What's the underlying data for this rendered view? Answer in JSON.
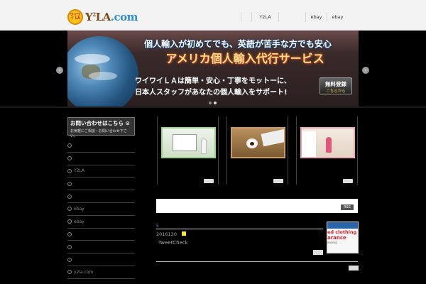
{
  "logo": {
    "badge_text": "ワイワイ LA",
    "wordmark_main": "Y",
    "wordmark_sup": "2",
    "wordmark_rest": "LA",
    "wordmark_tld": ".com"
  },
  "nav": {
    "items": [
      {
        "label": ""
      },
      {
        "label": "Y2LA"
      },
      {
        "label": ""
      },
      {
        "label": "ebay"
      },
      {
        "label": "ebay"
      }
    ]
  },
  "slider": {
    "headline": "個人輸入が初めてでも、英語が苦手な方でも安心",
    "title": "アメリカ個人輸入代行サービス",
    "line1": "ワイワイＬＡは簡単・安心・丁寧をモットーに、",
    "line2": "日本人スタッフがあなたの個人輸入をサポート!",
    "register_main": "無料登録",
    "register_sub": "こちらから",
    "prev_icon": "‹",
    "next_icon": "›",
    "dots_count": 2,
    "active_dot": 2
  },
  "sidebar": {
    "contact_title": "お問い合わせはこちら ⊙",
    "contact_sub": "お気軽にご相談・お問い合わせ下さい。",
    "bullet_icon": "›",
    "items": [
      {
        "label": ""
      },
      {
        "label": ""
      },
      {
        "label": "Y2LA"
      },
      {
        "label": ""
      },
      {
        "label": ""
      },
      {
        "label": "ebay"
      },
      {
        "label": "ebay"
      },
      {
        "label": ""
      },
      {
        "label": ""
      },
      {
        "label": ""
      },
      {
        "label": "y2la.com"
      }
    ]
  },
  "thumbs": [
    {
      "btn": "",
      "scene": "presentation"
    },
    {
      "btn": "",
      "scene": "coffee-keyboard"
    },
    {
      "btn": "",
      "scene": "office-woman"
    }
  ],
  "main": {
    "rss_label": "RSS",
    "post_tab": "5",
    "post_date": "2016130",
    "tweet_label": "TweetCheck",
    "more_btn": "",
    "bottom_btn": ""
  },
  "ad": {
    "line1": "ed clothing",
    "line2": "arance",
    "line3": "ending"
  },
  "colors": {
    "background": "#000000",
    "header": "#f3f3f3",
    "accent_yellow": "#ffe34a",
    "post_tab": "#8a6cd8"
  }
}
